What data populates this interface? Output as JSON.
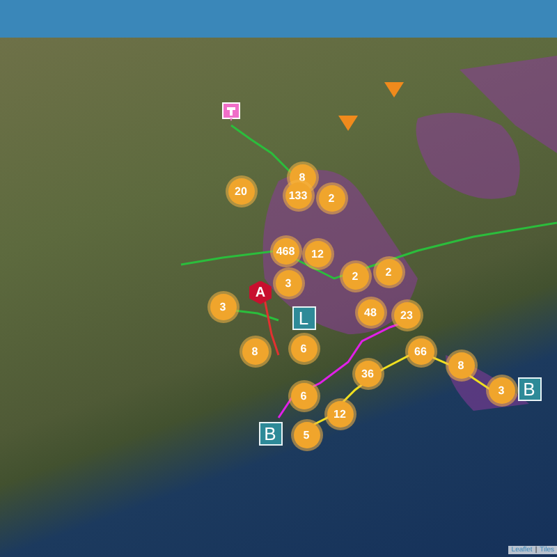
{
  "header": {
    "kind": "bar"
  },
  "clusters": [
    {
      "count": "8"
    },
    {
      "count": "133"
    },
    {
      "count": "2"
    },
    {
      "count": "20"
    },
    {
      "count": "468"
    },
    {
      "count": "12"
    },
    {
      "count": "2"
    },
    {
      "count": "2"
    },
    {
      "count": "3"
    },
    {
      "count": "3"
    },
    {
      "count": "48"
    },
    {
      "count": "23"
    },
    {
      "count": "8"
    },
    {
      "count": "6"
    },
    {
      "count": "36"
    },
    {
      "count": "6"
    },
    {
      "count": "12"
    },
    {
      "count": "5"
    },
    {
      "count": "66"
    },
    {
      "count": "8"
    },
    {
      "count": "3"
    }
  ],
  "markers": [
    {
      "kind": "hex",
      "letter": "A"
    },
    {
      "kind": "square",
      "letter": "L"
    },
    {
      "kind": "square",
      "letter": "B"
    },
    {
      "kind": "square",
      "letter": "B"
    }
  ],
  "poi_markers": [
    {
      "kind": "pin"
    },
    {
      "kind": "triangle"
    },
    {
      "kind": "triangle"
    }
  ],
  "attribution": {
    "links": [
      "Leaflet",
      "Tiles"
    ],
    "separator": "|"
  }
}
